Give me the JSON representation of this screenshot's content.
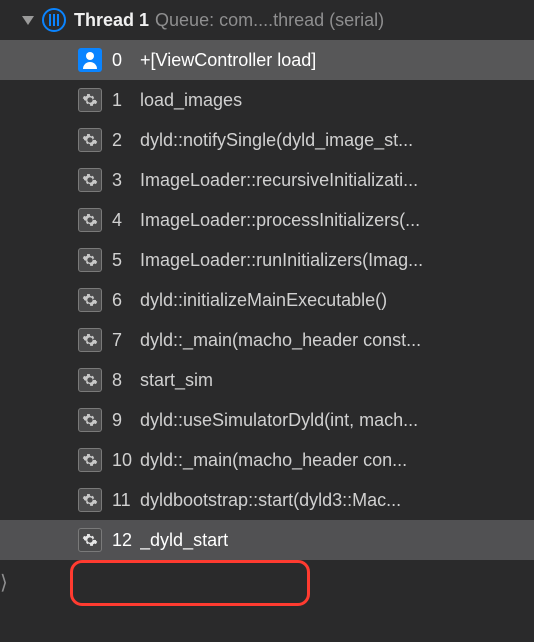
{
  "thread": {
    "title": "Thread 1",
    "subtitle": "Queue: com....thread (serial)"
  },
  "frames": [
    {
      "index": "0",
      "label": "+[ViewController load]",
      "kind": "user",
      "state": "selected"
    },
    {
      "index": "1",
      "label": "load_images",
      "kind": "system",
      "state": "normal"
    },
    {
      "index": "2",
      "label": "dyld::notifySingle(dyld_image_st...",
      "kind": "system",
      "state": "normal"
    },
    {
      "index": "3",
      "label": "ImageLoader::recursiveInitializati...",
      "kind": "system",
      "state": "normal"
    },
    {
      "index": "4",
      "label": "ImageLoader::processInitializers(...",
      "kind": "system",
      "state": "normal"
    },
    {
      "index": "5",
      "label": "ImageLoader::runInitializers(Imag...",
      "kind": "system",
      "state": "normal"
    },
    {
      "index": "6",
      "label": "dyld::initializeMainExecutable()",
      "kind": "system",
      "state": "normal"
    },
    {
      "index": "7",
      "label": "dyld::_main(macho_header const...",
      "kind": "system",
      "state": "normal"
    },
    {
      "index": "8",
      "label": "start_sim",
      "kind": "system",
      "state": "normal"
    },
    {
      "index": "9",
      "label": "dyld::useSimulatorDyld(int, mach...",
      "kind": "system",
      "state": "normal"
    },
    {
      "index": "10",
      "label": "dyld::_main(macho_header con...",
      "kind": "system",
      "state": "normal"
    },
    {
      "index": "11",
      "label": "dyldbootstrap::start(dyld3::Mac...",
      "kind": "system",
      "state": "normal"
    },
    {
      "index": "12",
      "label": "_dyld_start",
      "kind": "system",
      "state": "current"
    }
  ],
  "leftIndicator": "⟩"
}
